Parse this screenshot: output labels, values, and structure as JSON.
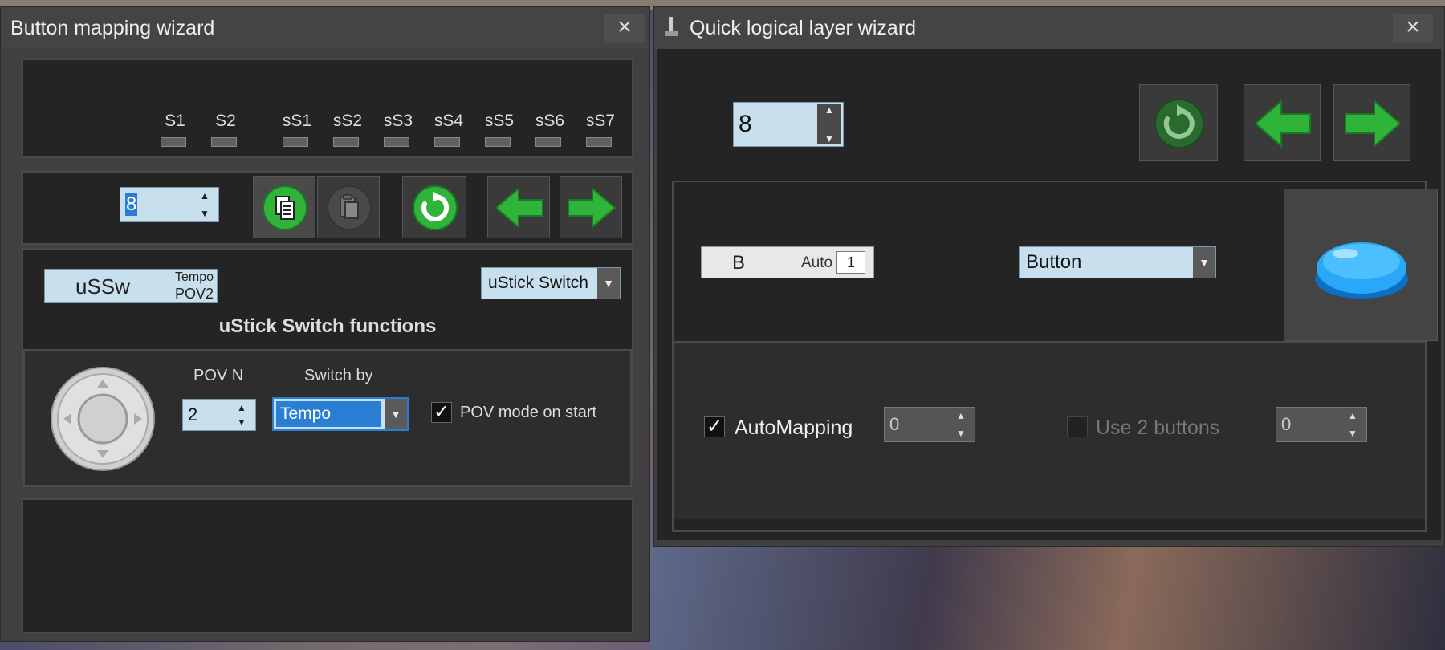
{
  "left_window": {
    "title": "Button mapping wizard",
    "close_glyph": "×",
    "switch_labels": [
      "S1",
      "S2",
      "sS1",
      "sS2",
      "sS3",
      "sS4",
      "sS5",
      "sS6",
      "sS7"
    ],
    "layer_value": "8",
    "ustick": {
      "badge_main": "uSSw",
      "badge_top": "Tempo",
      "badge_bottom": "POV2",
      "dropdown_value": "uStick Switch",
      "heading": "uStick Switch functions"
    },
    "pov": {
      "povn_label": "POV N",
      "povn_value": "2",
      "switchby_label": "Switch by",
      "switchby_value": "Tempo",
      "pov_mode_label": "POV mode on start",
      "pov_mode_checked": true
    },
    "icons": [
      "copy-icon",
      "paste-icon",
      "reset-icon",
      "arrow-left-icon",
      "arrow-right-icon",
      "joystick-pov-icon"
    ]
  },
  "right_window": {
    "title": "Quick logical layer wizard",
    "close_glyph": "×",
    "layer_value": "8",
    "button_id": {
      "letter": "B",
      "mode": "Auto",
      "number": "1"
    },
    "type_dropdown_value": "Button",
    "automapping_label": "AutoMapping",
    "automapping_checked": true,
    "automapping_value": "0",
    "use2buttons_label": "Use 2 buttons",
    "use2buttons_checked": false,
    "use2buttons_value": "0",
    "icons": [
      "reset-icon",
      "arrow-left-icon",
      "arrow-right-icon",
      "blue-button-icon"
    ]
  },
  "colors": {
    "green_accent": "#2fb33a",
    "input_bg": "#c8e0ee",
    "selection": "#2a7fd4",
    "blue_button": "#2aa8f8"
  }
}
